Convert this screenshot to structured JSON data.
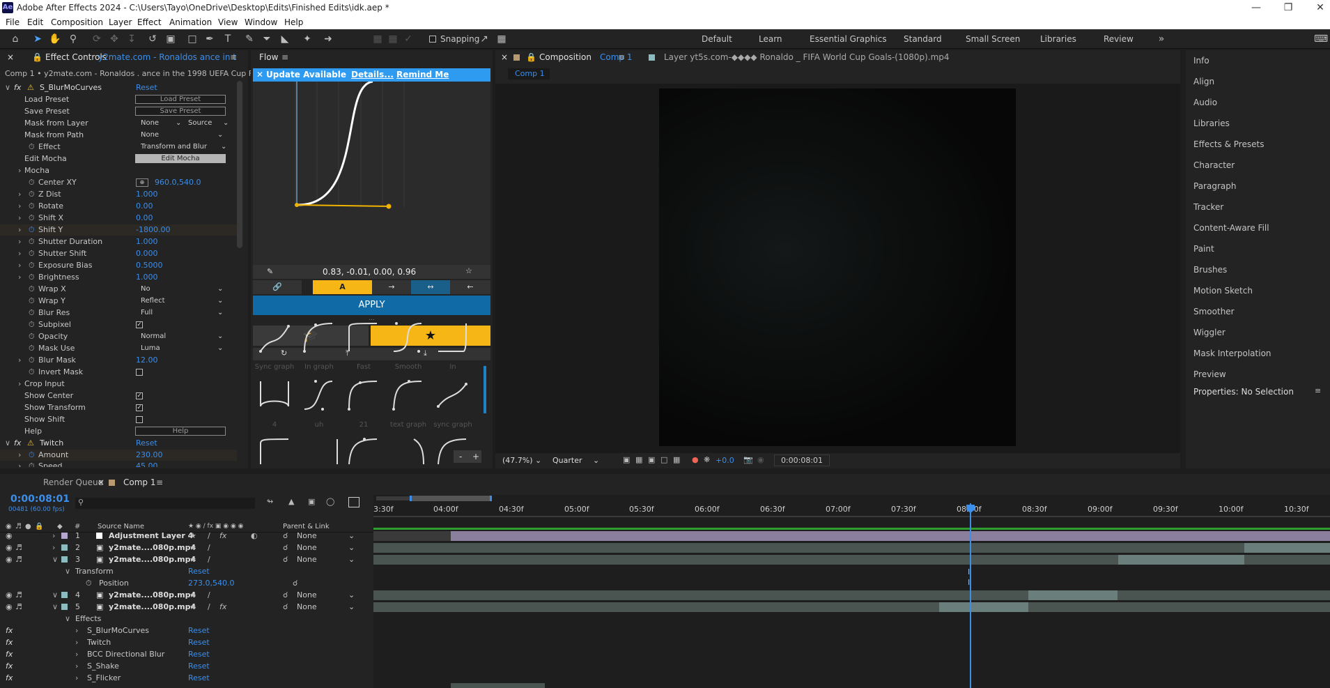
{
  "window": {
    "title": "Adobe After Effects 2024 - C:\\Users\\Tayo\\OneDrive\\Desktop\\Edits\\Finished Edits\\idk.aep *",
    "app_icon": "Ae"
  },
  "menu": [
    "File",
    "Edit",
    "Composition",
    "Layer",
    "Effect",
    "Animation",
    "View",
    "Window",
    "Help"
  ],
  "toolbar": {
    "snapping_label": "Snapping"
  },
  "workspaces": [
    "Default",
    "Learn",
    "Essential Graphics",
    "Standard",
    "Small Screen",
    "Libraries",
    "Review"
  ],
  "effect_controls": {
    "tab_label": "Effect Controls",
    "tab_layer": "y2mate.com - Ronaldos  ance in t",
    "breadcrumb": "Comp 1 • y2mate.com - Ronaldos  . ance in the 1998 UEFA Cup Final v",
    "fx1_name": "S_BlurMoCurves",
    "fx1_reset": "Reset",
    "load_preset": "Load Preset",
    "load_preset_btn": "Load Preset",
    "save_preset": "Save Preset",
    "save_preset_btn": "Save Preset",
    "mask_from_layer": "Mask from Layer",
    "mask_from_layer_val": "None",
    "mask_from_layer_src": "Source",
    "mask_from_path": "Mask from Path",
    "mask_from_path_val": "None",
    "effect": "Effect",
    "effect_val": "Transform and Blur",
    "edit_mocha": "Edit Mocha",
    "edit_mocha_btn": "Edit Mocha",
    "mocha": "Mocha",
    "center_xy": "Center XY",
    "center_xy_val": "960.0,540.0",
    "z_dist": "Z Dist",
    "z_dist_val": "1.000",
    "rotate": "Rotate",
    "rotate_val": "0.00",
    "shift_x": "Shift X",
    "shift_x_val": "0.00",
    "shift_y": "Shift Y",
    "shift_y_val": "-1800.00",
    "shutter_duration": "Shutter Duration",
    "shutter_duration_val": "1.000",
    "shutter_shift": "Shutter Shift",
    "shutter_shift_val": "0.000",
    "exposure_bias": "Exposure Bias",
    "exposure_bias_val": "0.5000",
    "brightness": "Brightness",
    "brightness_val": "1.000",
    "wrap_x": "Wrap X",
    "wrap_x_val": "No",
    "wrap_y": "Wrap Y",
    "wrap_y_val": "Reflect",
    "blur_res": "Blur Res",
    "blur_res_val": "Full",
    "subpixel": "Subpixel",
    "opacity": "Opacity",
    "opacity_val": "Normal",
    "mask_use": "Mask Use",
    "mask_use_val": "Luma",
    "blur_mask": "Blur Mask",
    "blur_mask_val": "12.00",
    "invert_mask": "Invert Mask",
    "crop_input": "Crop Input",
    "show_center": "Show Center",
    "show_transform": "Show Transform",
    "show_shift": "Show Shift",
    "help": "Help",
    "help_btn": "Help",
    "fx2_name": "Twitch",
    "fx2_reset": "Reset",
    "amount": "Amount",
    "amount_val": "230.00",
    "speed": "Speed",
    "speed_val": "45.00"
  },
  "flow": {
    "tab_label": "Flow",
    "update_text": "Update Available",
    "details": "Details...",
    "remind": "Remind Me",
    "bezier_values": "0.83, -0.01, 0.00, 0.96",
    "mode_label": "A",
    "apply": "APPLY",
    "dots": "...",
    "presets_row1": [
      "Sync graph",
      "In graph",
      "Fast",
      "Smooth",
      "In"
    ],
    "presets_row2": [
      "4",
      "uh",
      "21",
      "text graph",
      "sync graph"
    ],
    "minus": "-",
    "plus": "+"
  },
  "composition": {
    "tab_prefix": "Composition",
    "tab_comp": "Comp 1",
    "comp_chip": "Comp 1",
    "layer_tab": "Layer yt5s.com-◆◆◆◆ Ronaldo _ FIFA World Cup Goals-(1080p).mp4",
    "zoom": "(47.7%)",
    "resolution": "Quarter",
    "exposure": "+0.0",
    "timecode": "0:00:08:01"
  },
  "right_panels": [
    "Info",
    "Align",
    "Audio",
    "Libraries",
    "Effects & Presets",
    "Character",
    "Paragraph",
    "Tracker",
    "Content-Aware Fill",
    "Paint",
    "Brushes",
    "Motion Sketch",
    "Smoother",
    "Wiggler",
    "Mask Interpolation",
    "Preview"
  ],
  "properties": "Properties: No Selection",
  "timeline": {
    "render_queue": "Render Queue",
    "comp_tab": "Comp 1",
    "timecode": "0:00:08:01",
    "frames": "00481 (60.00 fps)",
    "col_source": "Source Name",
    "col_parent": "Parent & Link",
    "col_num": "#",
    "ruler": [
      "3:30f",
      "04:00f",
      "04:30f",
      "05:00f",
      "05:30f",
      "06:00f",
      "06:30f",
      "07:00f",
      "07:30f",
      "08:00f",
      "08:30f",
      "09:00f",
      "09:30f",
      "10:00f",
      "10:30f"
    ],
    "layers": [
      {
        "num": "1",
        "name": "Adjustment Layer 4",
        "parent": "None"
      },
      {
        "num": "2",
        "name": "y2mate....080p.mp4",
        "parent": "None"
      },
      {
        "num": "3",
        "name": "y2mate....080p.mp4",
        "parent": "None"
      },
      {
        "num": "4",
        "name": "y2mate....080p.mp4",
        "parent": "None"
      },
      {
        "num": "5",
        "name": "y2mate....080p.mp4",
        "parent": "None"
      }
    ],
    "transform": "Transform",
    "transform_reset": "Reset",
    "position": "Position",
    "position_val": "273.0,540.0",
    "effects": "Effects",
    "effect_list": [
      {
        "name": "S_BlurMoCurves",
        "reset": "Reset"
      },
      {
        "name": "Twitch",
        "reset": "Reset"
      },
      {
        "name": "BCC Directional Blur",
        "reset": "Reset"
      },
      {
        "name": "S_Shake",
        "reset": "Reset"
      },
      {
        "name": "S_Flicker",
        "reset": "Reset"
      }
    ]
  }
}
